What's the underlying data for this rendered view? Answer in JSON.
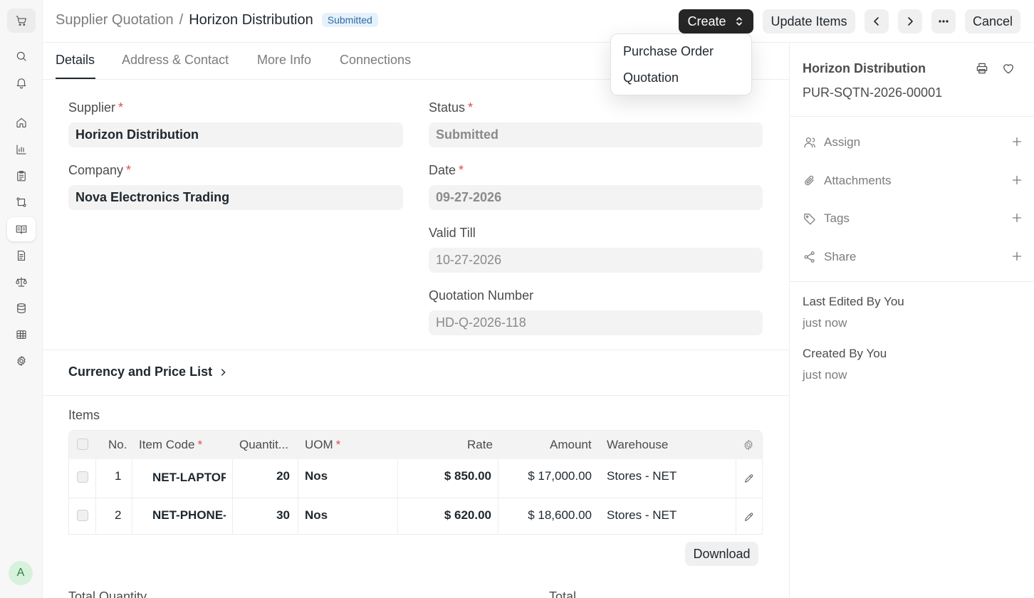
{
  "sidebar_nav": {
    "avatar_letter": "A",
    "icons": [
      "cart-icon",
      "search-icon",
      "bell-icon",
      "home-icon",
      "chart-icon",
      "clipboard-icon",
      "flow-icon",
      "book-icon",
      "document-icon",
      "scale-icon",
      "database-icon",
      "table-icon",
      "settings-icon"
    ],
    "active": "book-icon"
  },
  "header": {
    "breadcrumb_parent": "Supplier Quotation",
    "breadcrumb_sep": "/",
    "title": "Horizon Distribution",
    "status_badge": "Submitted",
    "create_label": "Create",
    "update_items_label": "Update Items",
    "cancel_label": "Cancel"
  },
  "create_menu": {
    "options": [
      "Purchase Order",
      "Quotation"
    ]
  },
  "tabs": [
    "Details",
    "Address & Contact",
    "More Info",
    "Connections"
  ],
  "active_tab": "Details",
  "form": {
    "supplier_label": "Supplier",
    "supplier_value": "Horizon Distribution",
    "company_label": "Company",
    "company_value": "Nova Electronics Trading",
    "status_label": "Status",
    "status_value": "Submitted",
    "date_label": "Date",
    "date_value": "09-27-2026",
    "valid_till_label": "Valid Till",
    "valid_till_value": "10-27-2026",
    "quotation_number_label": "Quotation Number",
    "quotation_number_value": "HD-Q-2026-118",
    "required_mark": "*"
  },
  "currency_section": {
    "title": "Currency and Price List"
  },
  "items": {
    "label": "Items",
    "columns": [
      "No.",
      "Item Code",
      "Quantit...",
      "UOM",
      "Rate",
      "Amount",
      "Warehouse"
    ],
    "rows": [
      {
        "no": "1",
        "item_code": "NET-LAPTOP",
        "qty": "20",
        "uom": "Nos",
        "rate": "$ 850.00",
        "amount": "$ 17,000.00",
        "warehouse": "Stores - NET"
      },
      {
        "no": "2",
        "item_code": "NET-PHONE-",
        "qty": "30",
        "uom": "Nos",
        "rate": "$ 620.00",
        "amount": "$ 18,600.00",
        "warehouse": "Stores - NET"
      }
    ],
    "download_label": "Download"
  },
  "totals": {
    "total_quantity_label": "Total Quantity",
    "total_label": "Total"
  },
  "side_panel": {
    "title": "Horizon Distribution",
    "doc_number": "PUR-SQTN-2026-00001",
    "actions": [
      "Assign",
      "Attachments",
      "Tags",
      "Share"
    ],
    "last_edited_label": "Last Edited By You",
    "last_edited_value": "just now",
    "created_label": "Created By You",
    "created_value": "just now"
  }
}
